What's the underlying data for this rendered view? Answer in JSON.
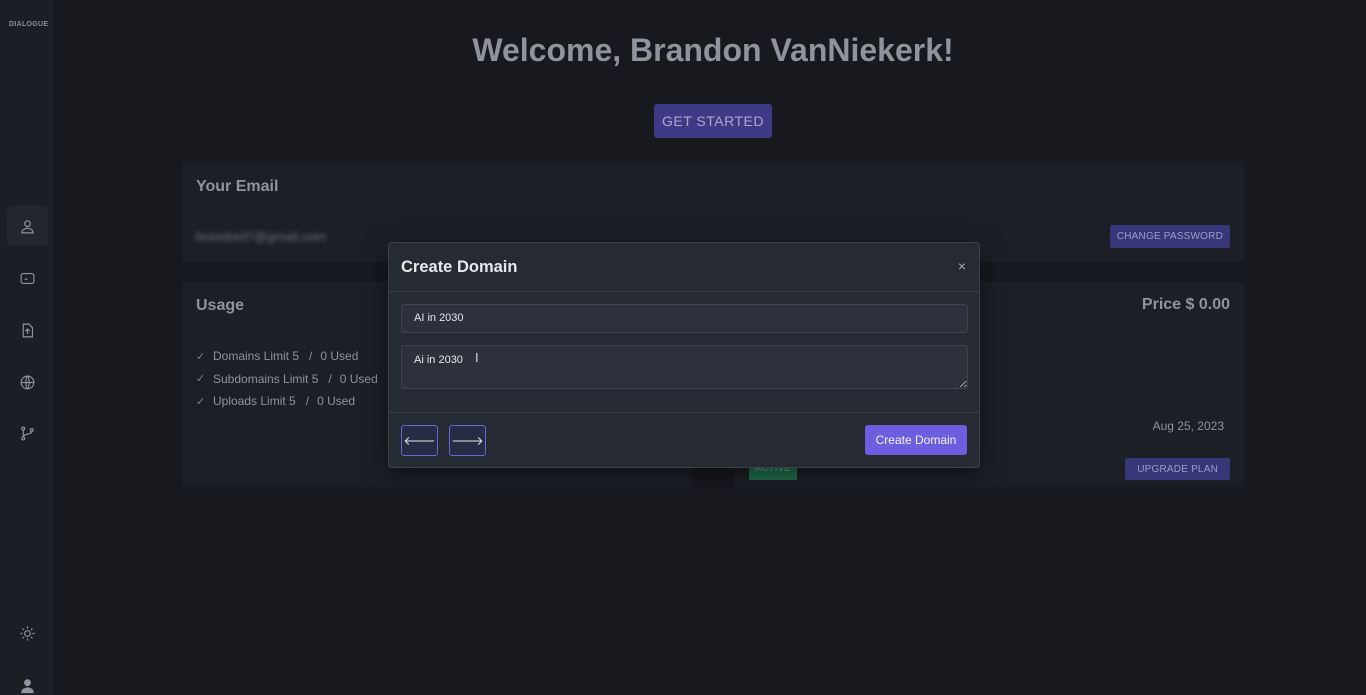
{
  "sidebar": {
    "logo_text": "DIALOGUE",
    "items": [
      {
        "name": "profile",
        "icon": "user-icon",
        "active": true
      },
      {
        "name": "chat",
        "icon": "message-icon",
        "active": false
      },
      {
        "name": "uploads",
        "icon": "file-upload-icon",
        "active": false
      },
      {
        "name": "domains",
        "icon": "globe-icon",
        "active": false
      },
      {
        "name": "branches",
        "icon": "git-branch-icon",
        "active": false
      }
    ],
    "bottom": [
      {
        "name": "theme",
        "icon": "sun-icon"
      },
      {
        "name": "account",
        "icon": "user-icon"
      }
    ]
  },
  "main": {
    "welcome": "Welcome, Brandon VanNiekerk!",
    "get_started_label": "GET STARTED",
    "email_card": {
      "title": "Your Email",
      "email": "brandonl7@gmail.com",
      "change_password_label": "CHANGE PASSWORD"
    },
    "usage_card": {
      "title": "Usage",
      "items": [
        {
          "label": "Domains Limit 5",
          "used": "0 Used"
        },
        {
          "label": "Subdomains Limit 5",
          "used": "0 Used"
        },
        {
          "label": "Uploads Limit 5",
          "used": "0 Used"
        }
      ]
    },
    "plan_card": {
      "price": "Price $ 0.00",
      "date": "Aug 25, 2023",
      "status": "ACTIVE",
      "upgrade_label": "UPGRADE PLAN"
    }
  },
  "modal": {
    "title": "Create Domain",
    "close_symbol": "×",
    "name_value": "AI in 2030",
    "description_value": "Ai in 2030",
    "prev_symbol": "🡐",
    "next_symbol": "🡒",
    "create_label": "Create Domain"
  },
  "colors": {
    "accent": "#6b5fe0",
    "background": "#17191f",
    "modal_bg": "#262a33"
  }
}
